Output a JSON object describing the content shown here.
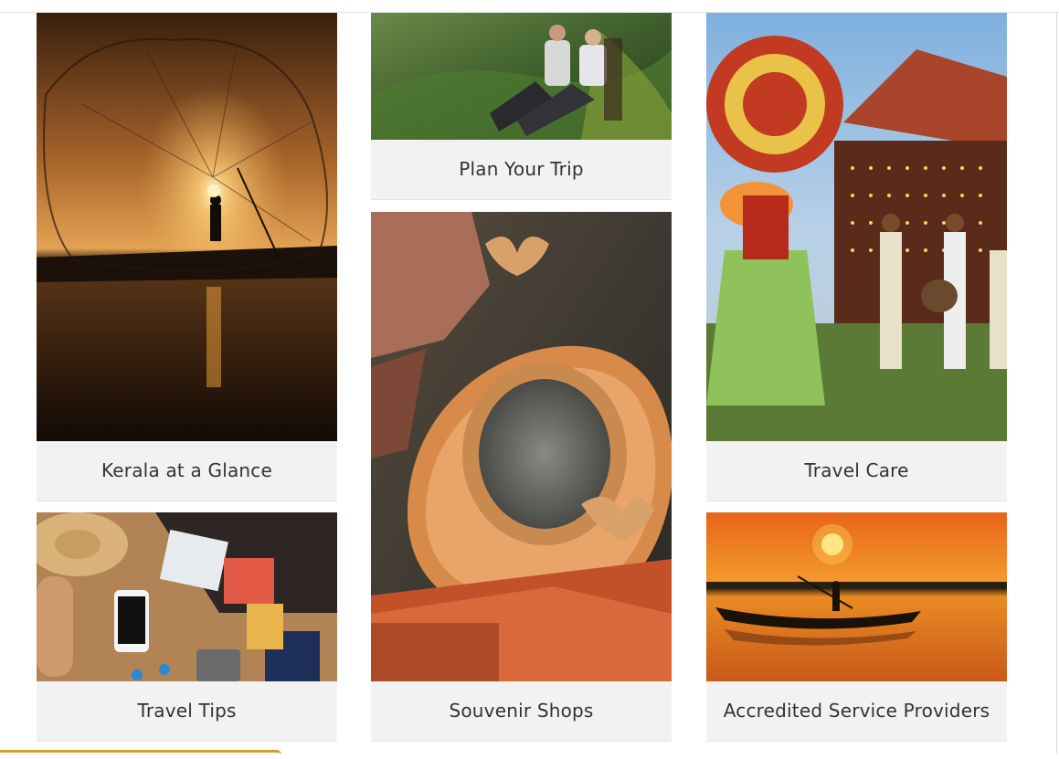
{
  "cards": [
    {
      "id": "kerala-at-a-glance",
      "label": "Kerala at a Glance",
      "image": "fisherman-casting-net-at-sunset"
    },
    {
      "id": "plan-your-trip",
      "label": "Plan Your Trip",
      "image": "couple-resting-on-hillside"
    },
    {
      "id": "travel-care",
      "label": "Travel Care",
      "image": "theyyam-dancer-with-fire-and-drummers"
    },
    {
      "id": "travel-tips",
      "label": "Travel Tips",
      "image": "travel-essentials-flat-lay"
    },
    {
      "id": "souvenir-shops",
      "label": "Souvenir Shops",
      "image": "bronze-aranmula-mirror-in-hand"
    },
    {
      "id": "accredited-service-providers",
      "label": "Accredited Service Providers",
      "image": "boatman-on-backwaters-at-sunset"
    }
  ],
  "colors": {
    "caption_bg": "#f2f2f2",
    "caption_text": "#333333",
    "accent": "#c9a227"
  }
}
